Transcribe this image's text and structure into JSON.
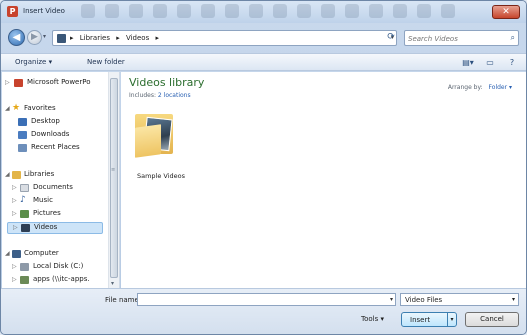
{
  "window": {
    "title": "Insert Video",
    "app_icon_letter": "P"
  },
  "address": {
    "crumbs": [
      "Libraries",
      "Videos"
    ],
    "separator": "▸"
  },
  "search": {
    "placeholder": "Search Videos"
  },
  "command_bar": {
    "organize": "Organize ▾",
    "new_folder": "New folder"
  },
  "nav_pane": {
    "items": [
      {
        "label": "Microsoft PowerPo",
        "icon": "powerpoint-icon",
        "arrow": "▷"
      },
      {
        "label": "Favorites",
        "icon": "star-icon",
        "arrow": "◢"
      },
      {
        "label": "Desktop",
        "icon": "desktop-icon",
        "arrow": ""
      },
      {
        "label": "Downloads",
        "icon": "downloads-icon",
        "arrow": ""
      },
      {
        "label": "Recent Places",
        "icon": "recent-places-icon",
        "arrow": ""
      },
      {
        "label": "Libraries",
        "icon": "libraries-icon",
        "arrow": "◢"
      },
      {
        "label": "Documents",
        "icon": "documents-icon",
        "arrow": "▷"
      },
      {
        "label": "Music",
        "icon": "music-icon",
        "arrow": "▷"
      },
      {
        "label": "Pictures",
        "icon": "pictures-icon",
        "arrow": "▷"
      },
      {
        "label": "Videos",
        "icon": "videos-icon",
        "arrow": "▷"
      },
      {
        "label": "Computer",
        "icon": "computer-icon",
        "arrow": "◢"
      },
      {
        "label": "Local Disk (C:)",
        "icon": "disk-icon",
        "arrow": "▷"
      },
      {
        "label": "apps (\\\\itc-apps.",
        "icon": "network-drive-icon",
        "arrow": "▷"
      }
    ]
  },
  "content": {
    "library_title": "Videos library",
    "includes_prefix": "Includes:",
    "includes_link": "2 locations",
    "arrange_label": "Arrange by:",
    "arrange_value": "Folder ▾",
    "folders": [
      {
        "label": "Sample Videos"
      }
    ]
  },
  "bottom": {
    "file_name_label": "File name:",
    "file_name_value": "",
    "file_type": "Video Files",
    "tools_label": "Tools ▾",
    "insert_label": "Insert",
    "cancel_label": "Cancel"
  },
  "colors": {
    "library_title": "#2b6d2e",
    "link": "#2a61b3",
    "selection": "#cde4f8"
  }
}
